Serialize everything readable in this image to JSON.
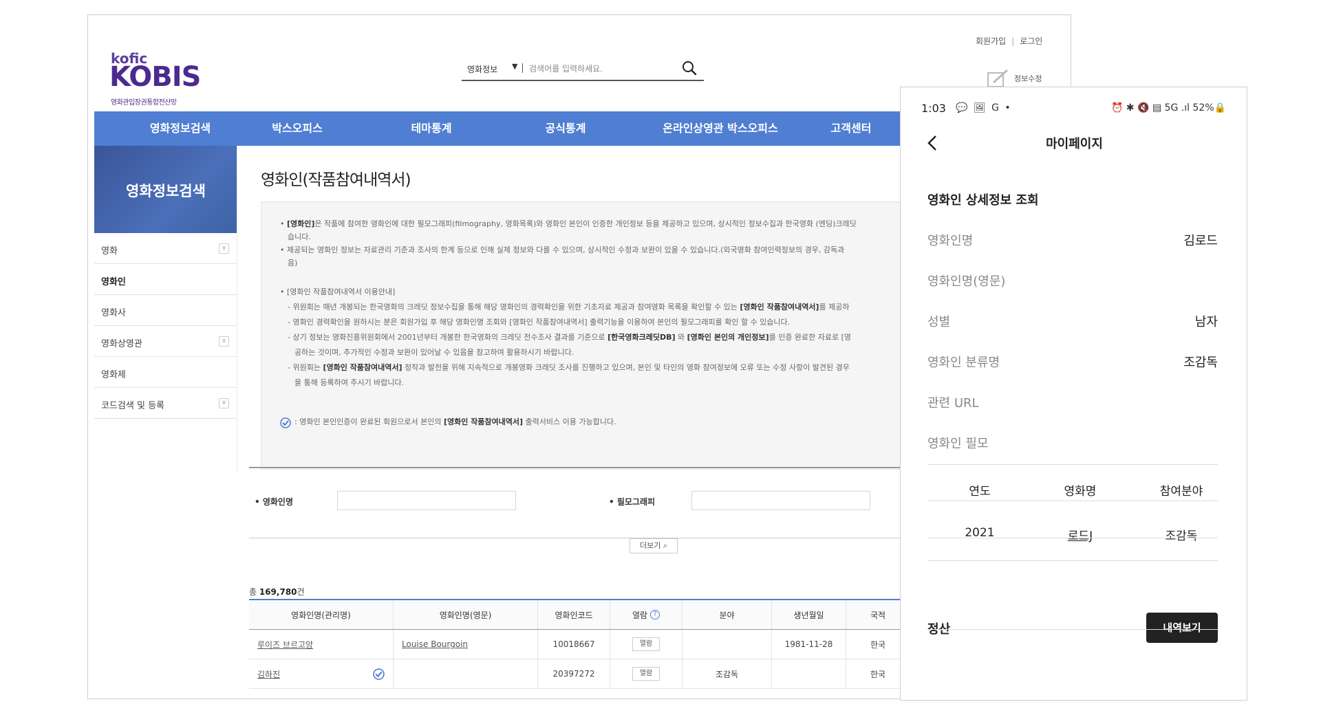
{
  "desktop": {
    "logo": {
      "top": "kofic",
      "main": "KOBIS",
      "sub": "영화관입장권통합전산망"
    },
    "search": {
      "category": "영화정보",
      "arrow": "▼",
      "placeholder": "검색어를 입력하세요."
    },
    "top_links": {
      "join": "회원가입",
      "login": "로그인"
    },
    "edit_info": "정보수정",
    "nav": [
      "영화정보검색",
      "박스오피스",
      "테마통계",
      "공식통계",
      "온라인상영관 박스오피스",
      "고객센터"
    ],
    "sidebar": {
      "title": "영화정보검색",
      "items": [
        {
          "label": "영화",
          "expandable": true
        },
        {
          "label": "영화인",
          "expandable": false,
          "active": true
        },
        {
          "label": "영화사",
          "expandable": false
        },
        {
          "label": "영화상영관",
          "expandable": true
        },
        {
          "label": "영화제",
          "expandable": false
        },
        {
          "label": "코드검색 및 등록",
          "expandable": true
        }
      ]
    },
    "page_title": "영화인(작품참여내역서)",
    "notice": {
      "l1_prefix": "• ",
      "l1_bold": "[영화인]",
      "l1_rest": "은 작품에 참여한 영화인에 대한 필모그래피(filmography, 영화목록)와 영화인 본인이 인증한 개인정보 등을 제공하고 있으며, 상시적인 정보수집과 한국영화 (엔딩)크레딧",
      "l2": "습니다.",
      "l3": "• 제공되는 영화인 정보는 자료관리 기준과 조사의 한계 등으로 인해 실제 정보와 다를 수 있으며, 상시적인 수정과 보완이 있을 수 있습니다.(외국영화 참여인력정보의 경우, 감독과",
      "l4": "음)",
      "l5": "• [영화인 작품참여내역서 이용안내]",
      "l6_a": "- 위원회는 매년 개봉되는 한국영화의 크레딧 정보수집을 통해 해당 영화인의 경력확인을 위한 기초자료 제공과 참여영화 목록을 확인할 수 있는 ",
      "l6_b": "[영화인 작품참여내역서]",
      "l6_c": "를 제공하",
      "l7": "- 영화인 경력확인을 원하시는 분은 회원가입 후 해당 영화인명 조회와 [영화인 작품참여내역서] 출력기능을 이용하여 본인의 필모그래피를 확인 할 수 있습니다.",
      "l8_a": "- 상기 정보는 영화진흥위원회에서 2001년부터 개봉한 한국영화의 크레딧 전수조사 결과를 기준으로 ",
      "l8_b": "[한국영화크레딧DB]",
      "l8_c": " 와 ",
      "l8_d": "[영화인 본인의 개인정보]",
      "l8_e": "를 인증 완료한 자료로 [영",
      "l9": "공하는 것이며, 추가적인 수정과 보완이 있어날 수 있음을 참고하여 활용하시기 바랍니다.",
      "l10_a": "- 위원회는 ",
      "l10_b": "[영화인 작품참여내역서]",
      "l10_c": " 정착과 발전을 위해 지속적으로 개봉영화 크레딧 조사를 진행하고 있으며, 본인 및 타인의 영화 참여정보에 오류 또는 수정 사항이 발견된 경우",
      "l11": "을 통해 등록하여 주시기 바랍니다.",
      "l12_a": ": 영화인 본인인증이 완료된 회원으로서 본인의 ",
      "l12_b": "[영화인 작품참여내역서]",
      "l12_c": " 출력서비스 이용 가능합니다."
    },
    "form": {
      "name_label": "• 영화인명",
      "filmo_label": "• 필모그래피",
      "more": "더보기"
    },
    "total": {
      "prefix": "총 ",
      "count": "169,780",
      "suffix": "건"
    },
    "table": {
      "headers": [
        "영화인명(관리명)",
        "영화인명(영문)",
        "영화인코드",
        "열람",
        "분야",
        "생년월일",
        "국적"
      ],
      "rows": [
        {
          "name": "루이즈 브르고앙",
          "name_en": "Louise Bourgoin",
          "code": "10018667",
          "view": "열람",
          "field": "",
          "birth": "1981-11-28",
          "nation": "한국"
        },
        {
          "name": "김하진",
          "name_en": "",
          "code": "20397272",
          "view": "열람",
          "field": "조감독",
          "birth": "",
          "nation": "한국"
        }
      ]
    }
  },
  "mobile": {
    "status_bar": {
      "time": "1:03",
      "left_icons": "💬 🖼 G •",
      "right": "⏰ ✱ 🔇 ▤ 5G .ıl 52%🔒"
    },
    "title": "마이페이지",
    "section_title": "영화인 상세정보 조회",
    "fields": [
      {
        "label": "영화인명",
        "value": "김로드"
      },
      {
        "label": "영화인명(영문)",
        "value": ""
      },
      {
        "label": "성별",
        "value": "남자"
      },
      {
        "label": "영화인 분류명",
        "value": "조감독"
      },
      {
        "label": "관련 URL",
        "value": ""
      },
      {
        "label": "영화인 필모",
        "value": ""
      }
    ],
    "filmo_headers": [
      "연도",
      "영화명",
      "참여분야"
    ],
    "filmo_rows": [
      {
        "year": "2021",
        "title": "로드J",
        "role": "조감독"
      }
    ],
    "settlement_label": "정산",
    "history_button": "내역보기"
  }
}
